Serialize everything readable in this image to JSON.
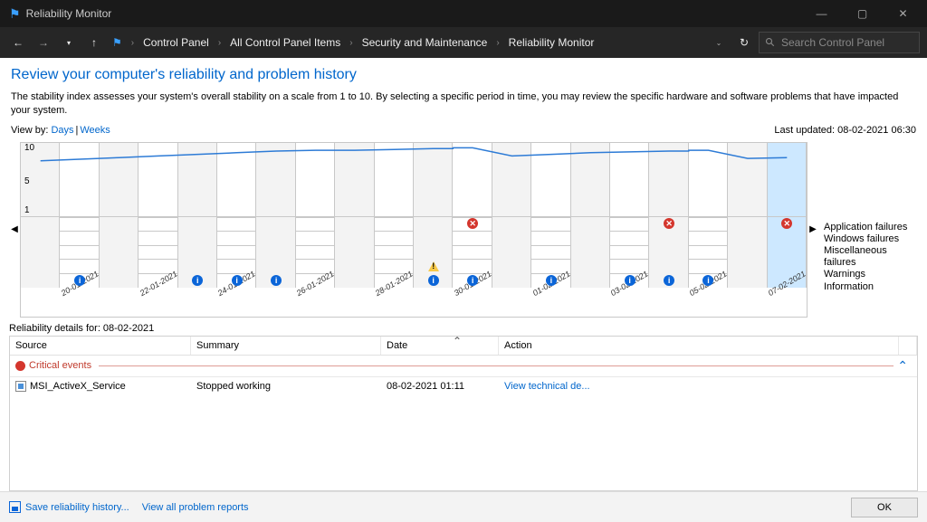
{
  "window": {
    "title": "Reliability Monitor"
  },
  "breadcrumbs": [
    "Control Panel",
    "All Control Panel Items",
    "Security and Maintenance",
    "Reliability Monitor"
  ],
  "search": {
    "placeholder": "Search Control Panel"
  },
  "heading": "Review your computer's reliability and problem history",
  "description": "The stability index assesses your system's overall stability on a scale from 1 to 10. By selecting a specific period in time, you may review the specific hardware and software problems that have impacted your system.",
  "view": {
    "label": "View by:",
    "days": "Days",
    "weeks": "Weeks",
    "last_updated": "Last updated: 08-02-2021 06:30"
  },
  "legend": {
    "app": "Application failures",
    "win": "Windows failures",
    "misc": "Miscellaneous failures",
    "warn": "Warnings",
    "info": "Information"
  },
  "details_for": "Reliability details for: 08-02-2021",
  "columns": {
    "source": "Source",
    "summary": "Summary",
    "date": "Date",
    "action": "Action"
  },
  "group_critical": "Critical events",
  "row1": {
    "source": "MSI_ActiveX_Service",
    "summary": "Stopped working",
    "date": "08-02-2021 01:11",
    "action": "View technical de..."
  },
  "footer": {
    "save": "Save reliability history...",
    "viewall": "View all problem reports",
    "ok": "OK"
  },
  "chart_data": {
    "type": "line",
    "ylim": [
      1,
      10
    ],
    "yticks": [
      10,
      5,
      1
    ],
    "categories": [
      "",
      "20-01-2021",
      "",
      "22-01-2021",
      "",
      "24-01-2021",
      "",
      "26-01-2021",
      "",
      "28-01-2021",
      "",
      "30-01-2021",
      "",
      "01-02-2021",
      "",
      "03-02-2021",
      "",
      "05-02-2021",
      "",
      "07-02-2021"
    ],
    "stability": [
      7.8,
      8.0,
      8.2,
      8.4,
      8.6,
      8.8,
      9.0,
      9.1,
      9.1,
      9.2,
      9.3,
      9.4,
      8.4,
      8.6,
      8.8,
      8.9,
      9.0,
      9.1,
      8.1,
      8.2
    ],
    "icons": {
      "app_failures": [
        12,
        17,
        20
      ],
      "windows_failures": [],
      "misc_failures": [],
      "warnings": [
        11
      ],
      "information": [
        2,
        5,
        6,
        7,
        11,
        12,
        14,
        16,
        17,
        18
      ]
    },
    "drop_cols": [
      12,
      18
    ]
  }
}
